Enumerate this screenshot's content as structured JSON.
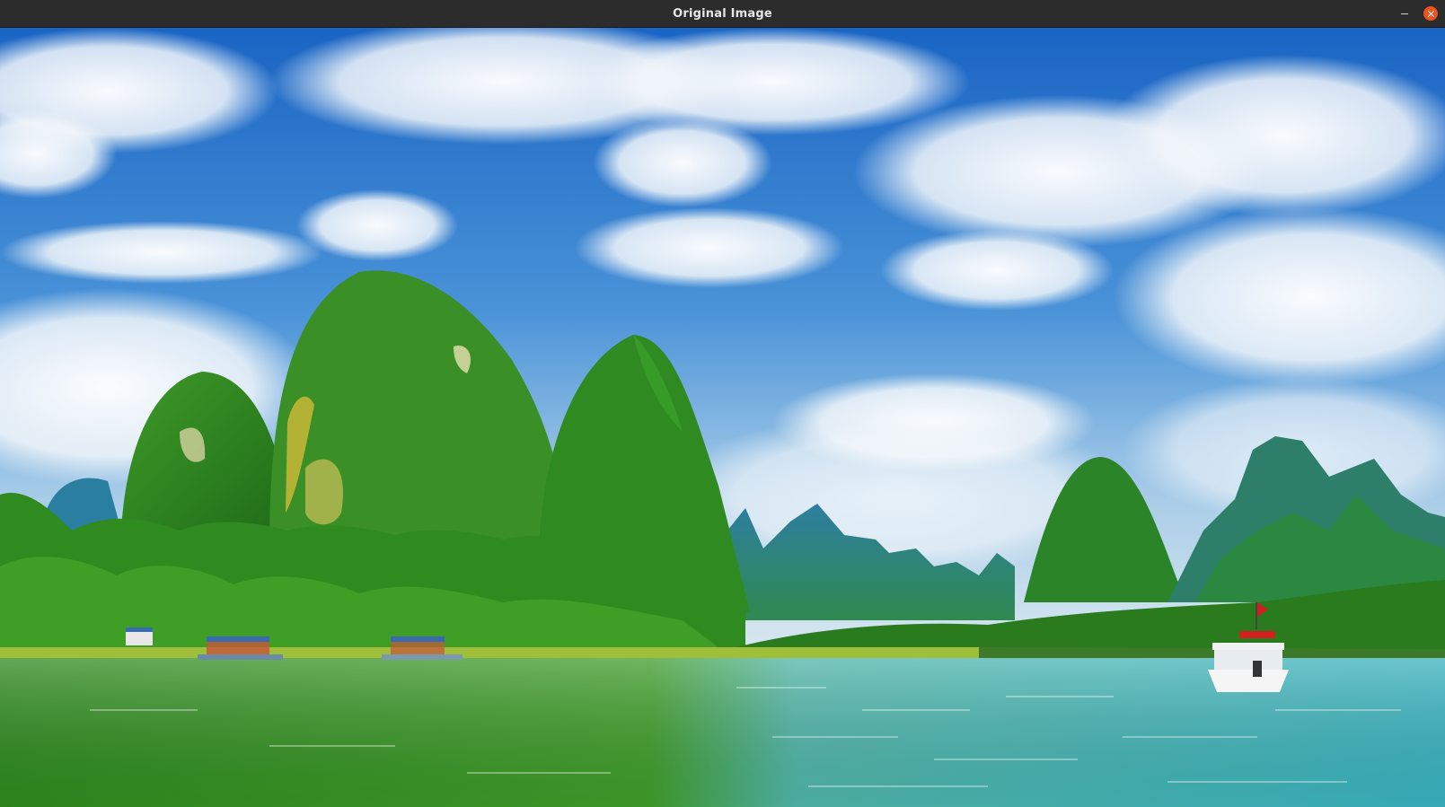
{
  "window": {
    "title": "Original Image"
  },
  "controls": {
    "minimize_icon": "minimize-icon",
    "close_icon": "close-icon",
    "close_color": "#e95420"
  },
  "image": {
    "palette": {
      "sky_top": "#1e6fc9",
      "sky_bottom": "#b9d6ea",
      "mountain": "#2f8a22",
      "distant_mountain": "#2a7d6a",
      "water_left": "#3f9a2a",
      "water_right": "#4fb8b8"
    }
  }
}
